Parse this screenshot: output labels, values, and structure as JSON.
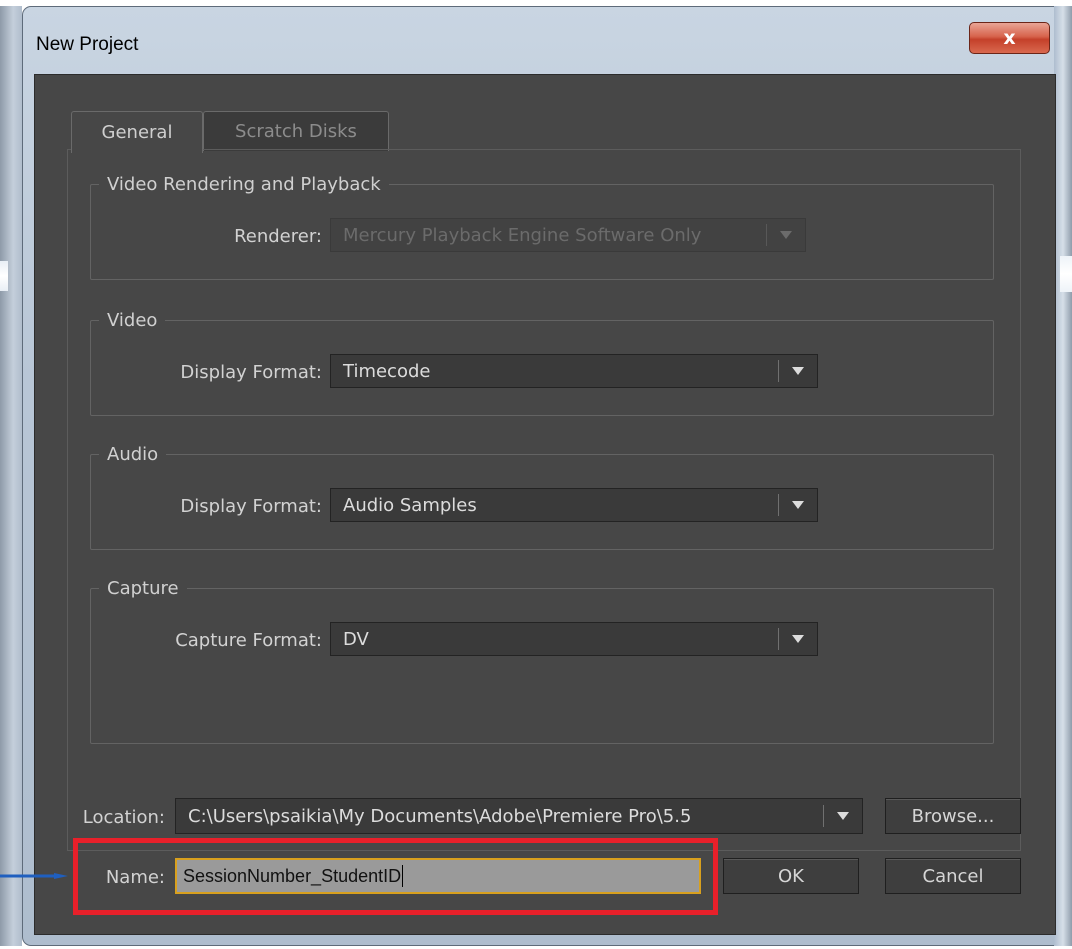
{
  "window": {
    "title": "New Project",
    "close_glyph": "x"
  },
  "tabs": [
    {
      "label": "General",
      "active": true
    },
    {
      "label": "Scratch Disks",
      "active": false
    }
  ],
  "groups": {
    "video_rendering": {
      "legend": "Video Rendering and Playback",
      "renderer_label": "Renderer:",
      "renderer_value": "Mercury Playback Engine Software Only"
    },
    "video": {
      "legend": "Video",
      "display_format_label": "Display Format:",
      "display_format_value": "Timecode"
    },
    "audio": {
      "legend": "Audio",
      "display_format_label": "Display Format:",
      "display_format_value": "Audio Samples"
    },
    "capture": {
      "legend": "Capture",
      "capture_format_label": "Capture Format:",
      "capture_format_value": "DV"
    }
  },
  "location": {
    "label": "Location:",
    "value": "C:\\Users\\psaikia\\My Documents\\Adobe\\Premiere Pro\\5.5",
    "browse_label": "Browse..."
  },
  "name": {
    "label": "Name:",
    "value": "SessionNumber_StudentID"
  },
  "buttons": {
    "ok_label": "OK",
    "cancel_label": "Cancel"
  },
  "colors": {
    "highlight": "#e8202a",
    "arrow": "#1f5fbf",
    "focus": "#d8a01e"
  }
}
